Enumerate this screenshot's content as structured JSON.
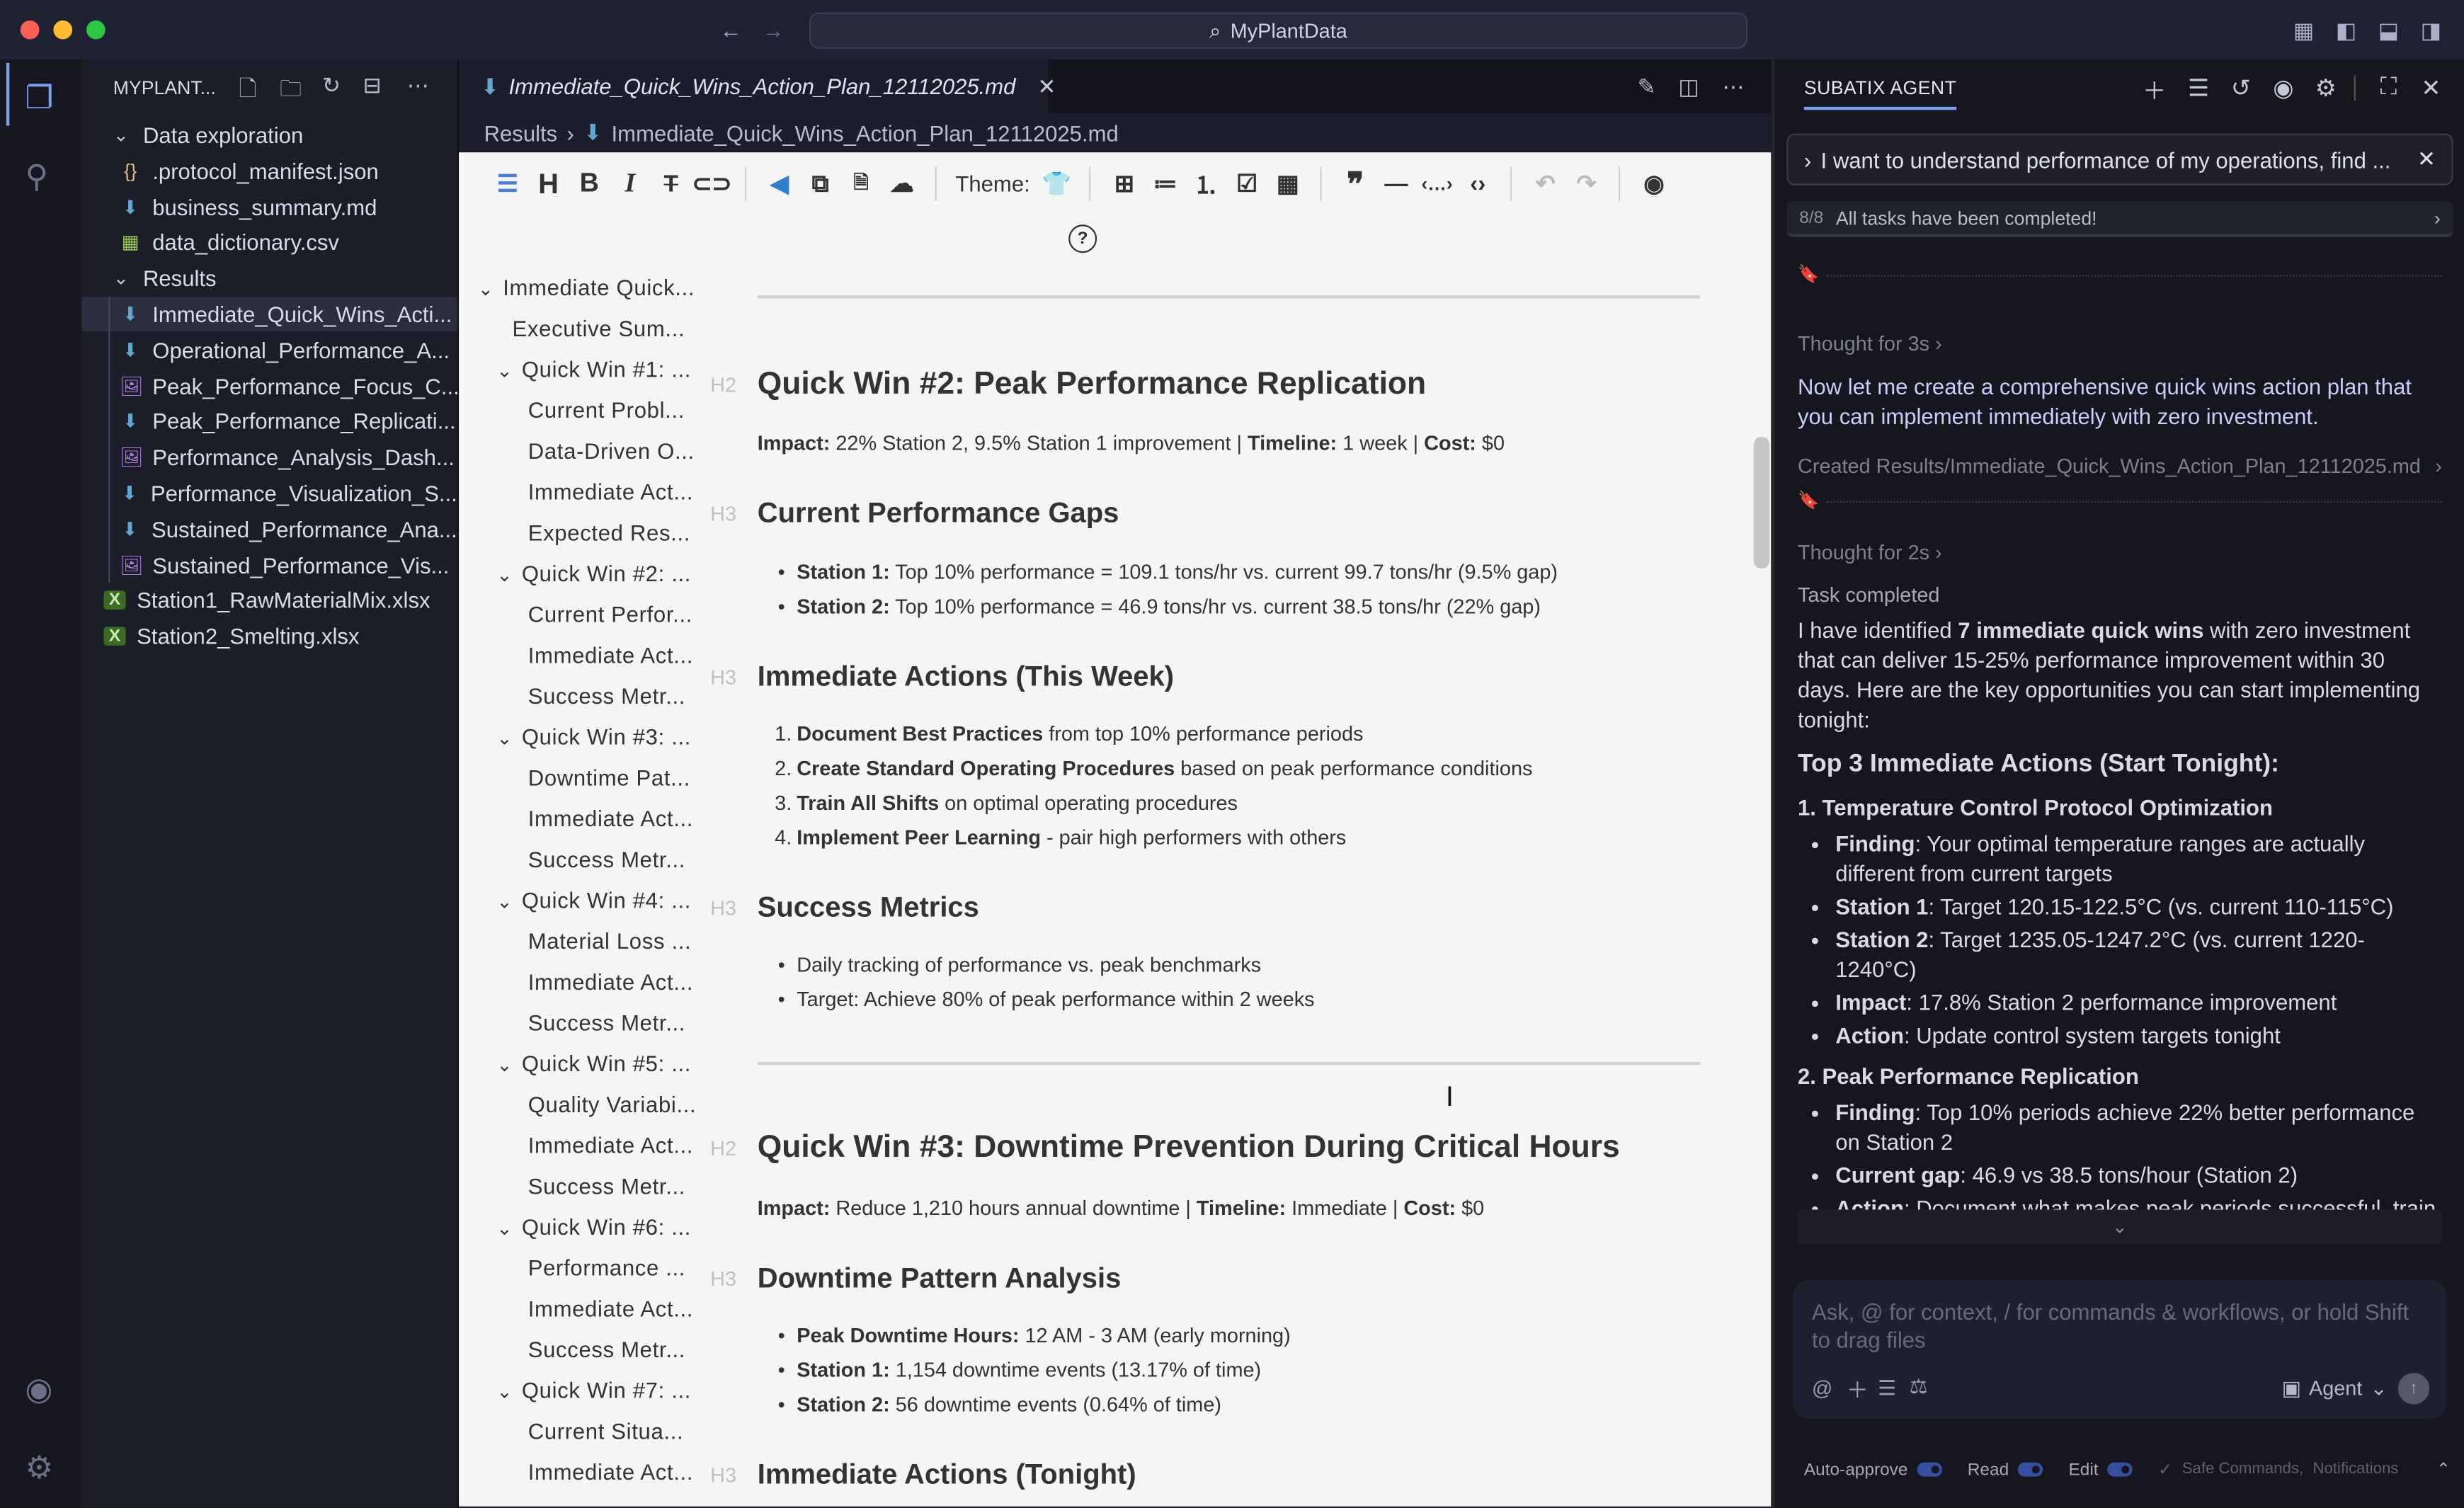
{
  "window": {
    "search_label": "MyPlantData"
  },
  "explorer": {
    "title": "MYPLANT...",
    "items": [
      {
        "label": "Data exploration",
        "kind": "folder",
        "depth": 0
      },
      {
        "label": ".protocol_manifest.json",
        "kind": "json",
        "depth": 1
      },
      {
        "label": "business_summary.md",
        "kind": "md",
        "depth": 1
      },
      {
        "label": "data_dictionary.csv",
        "kind": "csv",
        "depth": 1
      },
      {
        "label": "Results",
        "kind": "folder",
        "depth": 0
      },
      {
        "label": "Immediate_Quick_Wins_Acti...",
        "kind": "md",
        "depth": 1,
        "selected": true
      },
      {
        "label": "Operational_Performance_A...",
        "kind": "md",
        "depth": 1
      },
      {
        "label": "Peak_Performance_Focus_C...",
        "kind": "img",
        "depth": 1
      },
      {
        "label": "Peak_Performance_Replicati...",
        "kind": "md",
        "depth": 1
      },
      {
        "label": "Performance_Analysis_Dash...",
        "kind": "img",
        "depth": 1
      },
      {
        "label": "Performance_Visualization_S...",
        "kind": "md",
        "depth": 1
      },
      {
        "label": "Sustained_Performance_Ana...",
        "kind": "md",
        "depth": 1
      },
      {
        "label": "Sustained_Performance_Vis...",
        "kind": "img",
        "depth": 1
      },
      {
        "label": "Station1_RawMaterialMix.xlsx",
        "kind": "xlsx",
        "depth": 0
      },
      {
        "label": "Station2_Smelting.xlsx",
        "kind": "xlsx",
        "depth": 0
      }
    ]
  },
  "editor": {
    "tab_label": "Immediate_Quick_Wins_Action_Plan_12112025.md",
    "breadcrumb": [
      "Results",
      "Immediate_Quick_Wins_Action_Plan_12112025.md"
    ],
    "theme_label": "Theme:"
  },
  "outline": [
    {
      "label": "Immediate Quick...",
      "level": 0,
      "chev": true
    },
    {
      "label": "Executive Sum...",
      "level": 1
    },
    {
      "label": "Quick Win #1: ...",
      "level": 1,
      "chev": true
    },
    {
      "label": "Current Probl...",
      "level": 2
    },
    {
      "label": "Data-Driven O...",
      "level": 2
    },
    {
      "label": "Immediate Act...",
      "level": 2
    },
    {
      "label": "Expected Res...",
      "level": 2
    },
    {
      "label": "Quick Win #2: ...",
      "level": 1,
      "chev": true
    },
    {
      "label": "Current Perfor...",
      "level": 2
    },
    {
      "label": "Immediate Act...",
      "level": 2
    },
    {
      "label": "Success Metr...",
      "level": 2
    },
    {
      "label": "Quick Win #3: ...",
      "level": 1,
      "chev": true
    },
    {
      "label": "Downtime Pat...",
      "level": 2
    },
    {
      "label": "Immediate Act...",
      "level": 2
    },
    {
      "label": "Success Metr...",
      "level": 2
    },
    {
      "label": "Quick Win #4: ...",
      "level": 1,
      "chev": true
    },
    {
      "label": "Material Loss ...",
      "level": 2
    },
    {
      "label": "Immediate Act...",
      "level": 2
    },
    {
      "label": "Success Metr...",
      "level": 2
    },
    {
      "label": "Quick Win #5: ...",
      "level": 1,
      "chev": true
    },
    {
      "label": "Quality Variabi...",
      "level": 2
    },
    {
      "label": "Immediate Act...",
      "level": 2
    },
    {
      "label": "Success Metr...",
      "level": 2
    },
    {
      "label": "Quick Win #6: ...",
      "level": 1,
      "chev": true
    },
    {
      "label": "Performance ...",
      "level": 2
    },
    {
      "label": "Immediate Act...",
      "level": 2
    },
    {
      "label": "Success Metr...",
      "level": 2
    },
    {
      "label": "Quick Win #7: ...",
      "level": 1,
      "chev": true
    },
    {
      "label": "Current Situa...",
      "level": 2
    },
    {
      "label": "Immediate Act...",
      "level": 2
    }
  ],
  "document": [
    {
      "type": "hr"
    },
    {
      "type": "h2",
      "tag": "H2",
      "segs": [
        {
          "t": "Quick Win #2: Peak Performance Replication"
        }
      ]
    },
    {
      "type": "p",
      "segs": [
        {
          "b": "Impact:"
        },
        {
          "t": " 22% Station 2, 9.5% Station 1 improvement | "
        },
        {
          "b": "Timeline:"
        },
        {
          "t": " 1 week | "
        },
        {
          "b": "Cost:"
        },
        {
          "t": " $0"
        }
      ]
    },
    {
      "type": "h3",
      "tag": "H3",
      "segs": [
        {
          "t": "Current Performance Gaps"
        }
      ]
    },
    {
      "type": "li",
      "segs": [
        {
          "b": "Station 1:"
        },
        {
          "t": " Top 10% performance = 109.1 tons/hr vs. current 99.7 tons/hr (9.5% gap)"
        }
      ]
    },
    {
      "type": "li",
      "segs": [
        {
          "b": "Station 2:"
        },
        {
          "t": " Top 10% performance = 46.9 tons/hr vs. current 38.5 tons/hr (22% gap)"
        }
      ]
    },
    {
      "type": "h3",
      "tag": "H3",
      "segs": [
        {
          "t": "Immediate Actions (This Week)"
        }
      ]
    },
    {
      "type": "ol",
      "num": "1.",
      "segs": [
        {
          "b": "Document Best Practices"
        },
        {
          "t": " from top 10% performance periods"
        }
      ]
    },
    {
      "type": "ol",
      "num": "2.",
      "segs": [
        {
          "b": "Create Standard Operating Procedures"
        },
        {
          "t": " based on peak performance conditions"
        }
      ]
    },
    {
      "type": "ol",
      "num": "3.",
      "segs": [
        {
          "b": "Train All Shifts"
        },
        {
          "t": " on optimal operating procedures"
        }
      ]
    },
    {
      "type": "ol",
      "num": "4.",
      "segs": [
        {
          "b": "Implement Peer Learning"
        },
        {
          "t": " - pair high performers with others"
        }
      ]
    },
    {
      "type": "h3",
      "tag": "H3",
      "segs": [
        {
          "t": "Success Metrics"
        }
      ]
    },
    {
      "type": "li",
      "segs": [
        {
          "t": "Daily tracking of performance vs. peak benchmarks"
        }
      ]
    },
    {
      "type": "li",
      "segs": [
        {
          "t": "Target: Achieve 80% of peak performance within 2 weeks"
        }
      ]
    },
    {
      "type": "hr"
    },
    {
      "type": "h2",
      "tag": "H2",
      "segs": [
        {
          "t": "Quick Win #3: Downtime Prevention During Critical Hours"
        }
      ]
    },
    {
      "type": "p",
      "segs": [
        {
          "b": "Impact:"
        },
        {
          "t": " Reduce 1,210 hours annual downtime | "
        },
        {
          "b": "Timeline:"
        },
        {
          "t": " Immediate | "
        },
        {
          "b": "Cost:"
        },
        {
          "t": " $0"
        }
      ]
    },
    {
      "type": "h3",
      "tag": "H3",
      "segs": [
        {
          "t": "Downtime Pattern Analysis"
        }
      ]
    },
    {
      "type": "li",
      "segs": [
        {
          "b": "Peak Downtime Hours:"
        },
        {
          "t": " 12 AM - 3 AM (early morning)"
        }
      ]
    },
    {
      "type": "li",
      "segs": [
        {
          "b": "Station 1:"
        },
        {
          "t": " 1,154 downtime events (13.17% of time)"
        }
      ]
    },
    {
      "type": "li",
      "segs": [
        {
          "b": "Station 2:"
        },
        {
          "t": " 56 downtime events (0.64% of time)"
        }
      ]
    },
    {
      "type": "h3",
      "tag": "H3",
      "segs": [
        {
          "t": "Immediate Actions (Tonight)"
        }
      ]
    }
  ],
  "agent": {
    "title": "SUBATIX AGENT",
    "query": "I want to understand performance of my operations, find ...",
    "task_count": "8/8",
    "task_status": "All tasks have been completed!",
    "thought1": "Thought for 3s",
    "message1": "Now let me create a comprehensive quick wins action plan that you can implement immediately with zero investment.",
    "created": "Created Results/Immediate_Quick_Wins_Action_Plan_12112025.md",
    "thought2": "Thought for 2s",
    "task_completed": "Task completed",
    "summary": [
      {
        "t": "I have identified "
      },
      {
        "b": "7 immediate quick wins"
      },
      {
        "t": " with zero investment that can deliver 15-25% performance improvement within 30 days. Here are the key opportunities you can start implementing tonight:"
      }
    ],
    "heading": "Top 3 Immediate Actions (Start Tonight):",
    "sections": [
      {
        "title": "1. Temperature Control Protocol Optimization",
        "bullets": [
          [
            {
              "b": "Finding"
            },
            {
              "t": ": Your optimal temperature ranges are actually different from current targets"
            }
          ],
          [
            {
              "b": "Station 1"
            },
            {
              "t": ": Target 120.15-122.5°C (vs. current 110-115°C)"
            }
          ],
          [
            {
              "b": "Station 2"
            },
            {
              "t": ": Target 1235.05-1247.2°C (vs. current 1220-1240°C)"
            }
          ],
          [
            {
              "b": "Impact"
            },
            {
              "t": ": 17.8% Station 2 performance improvement"
            }
          ],
          [
            {
              "b": "Action"
            },
            {
              "t": ": Update control system targets tonight"
            }
          ]
        ]
      },
      {
        "title": "2. Peak Performance Replication",
        "bullets": [
          [
            {
              "b": "Finding"
            },
            {
              "t": ": Top 10% periods achieve 22% better performance on Station 2"
            }
          ],
          [
            {
              "b": "Current gap"
            },
            {
              "t": ": 46.9 vs 38.5 tons/hour (Station 2)"
            }
          ],
          [
            {
              "b": "Action"
            },
            {
              "t": ": Document what makes peak periods successful, train"
            }
          ]
        ]
      }
    ],
    "input_placeholder": "Ask, @ for context, / for commands & workflows, or hold Shift to drag files",
    "mode_label": "Agent",
    "footer": {
      "auto_approve": "Auto-approve",
      "read": "Read",
      "edit": "Edit",
      "safe": "Safe Commands,",
      "notifications": "Notifications"
    }
  },
  "colors": {
    "accent": "#7b9cf0",
    "md_icon": "#5fa8d3",
    "img_icon": "#b07ee0",
    "xlsx_icon": "#7bb848",
    "json_icon": "#e5c07b"
  }
}
